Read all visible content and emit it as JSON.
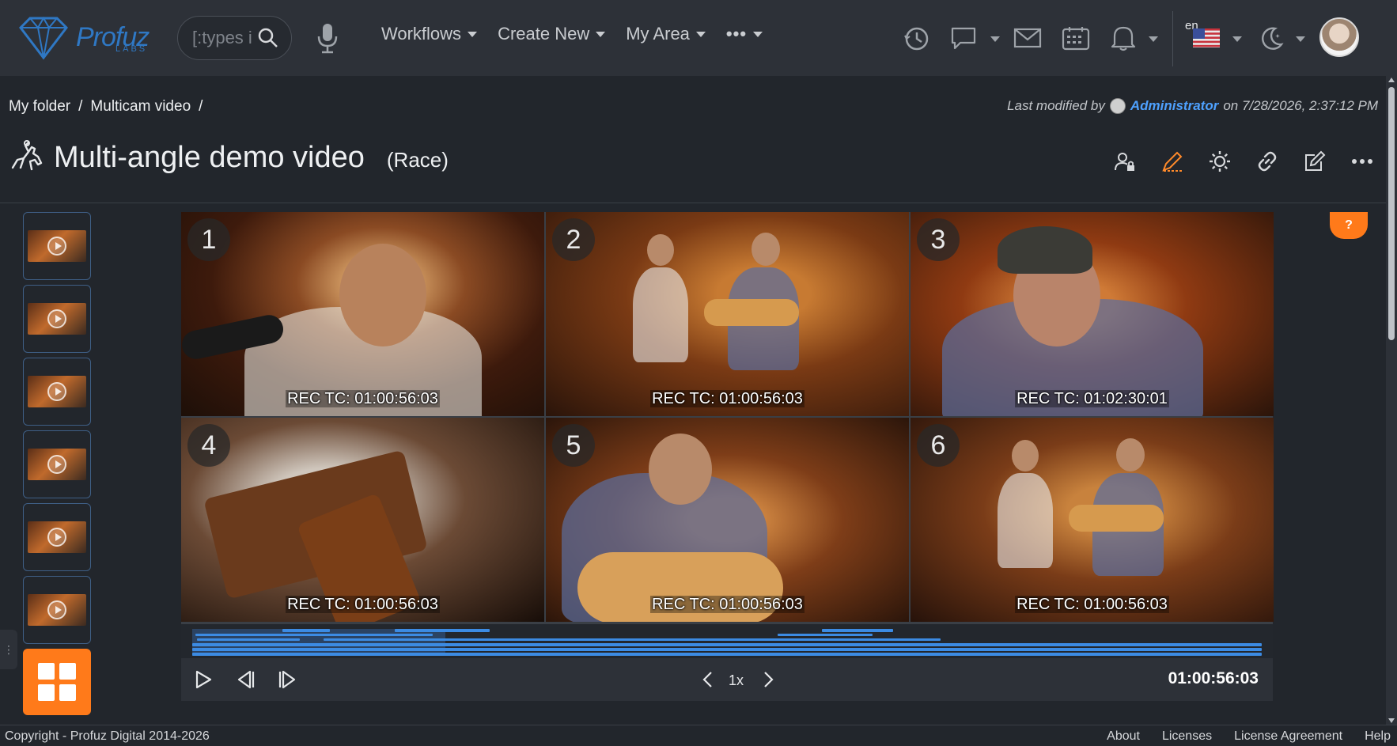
{
  "topbar": {
    "logo_text": "Profuz",
    "logo_sub": "LABS",
    "search_placeholder": "[:types i",
    "nav": [
      {
        "label": "Workflows"
      },
      {
        "label": "Create New"
      },
      {
        "label": "My Area"
      },
      {
        "label": "•••"
      }
    ],
    "lang": "en"
  },
  "breadcrumb": {
    "items": [
      "My folder",
      "Multicam video"
    ],
    "separator": "/"
  },
  "last_modified": {
    "prefix": "Last modified by",
    "user": "Administrator",
    "suffix": "on 7/28/2026, 2:37:12 PM"
  },
  "page": {
    "title": "Multi-angle demo video",
    "subtitle": "(Race)"
  },
  "help_label": "?",
  "cameras": [
    {
      "num": "1",
      "rec": "REC TC: 01:00:56:03"
    },
    {
      "num": "2",
      "rec": "REC TC: 01:00:56:03"
    },
    {
      "num": "3",
      "rec": "REC TC: 01:02:30:01"
    },
    {
      "num": "4",
      "rec": "REC TC: 01:00:56:03"
    },
    {
      "num": "5",
      "rec": "REC TC: 01:00:56:03"
    },
    {
      "num": "6",
      "rec": "REC TC: 01:00:56:03"
    }
  ],
  "controls": {
    "speed": "1x",
    "timecode": "01:00:56:03"
  },
  "footer": {
    "copyright": "Copyright - Profuz Digital 2014-2026",
    "links": [
      "About",
      "Licenses",
      "License Agreement",
      "Help"
    ]
  },
  "colors": {
    "accent": "#ff7a1a",
    "link": "#4ea1ff",
    "timeline": "#3c8be3"
  }
}
